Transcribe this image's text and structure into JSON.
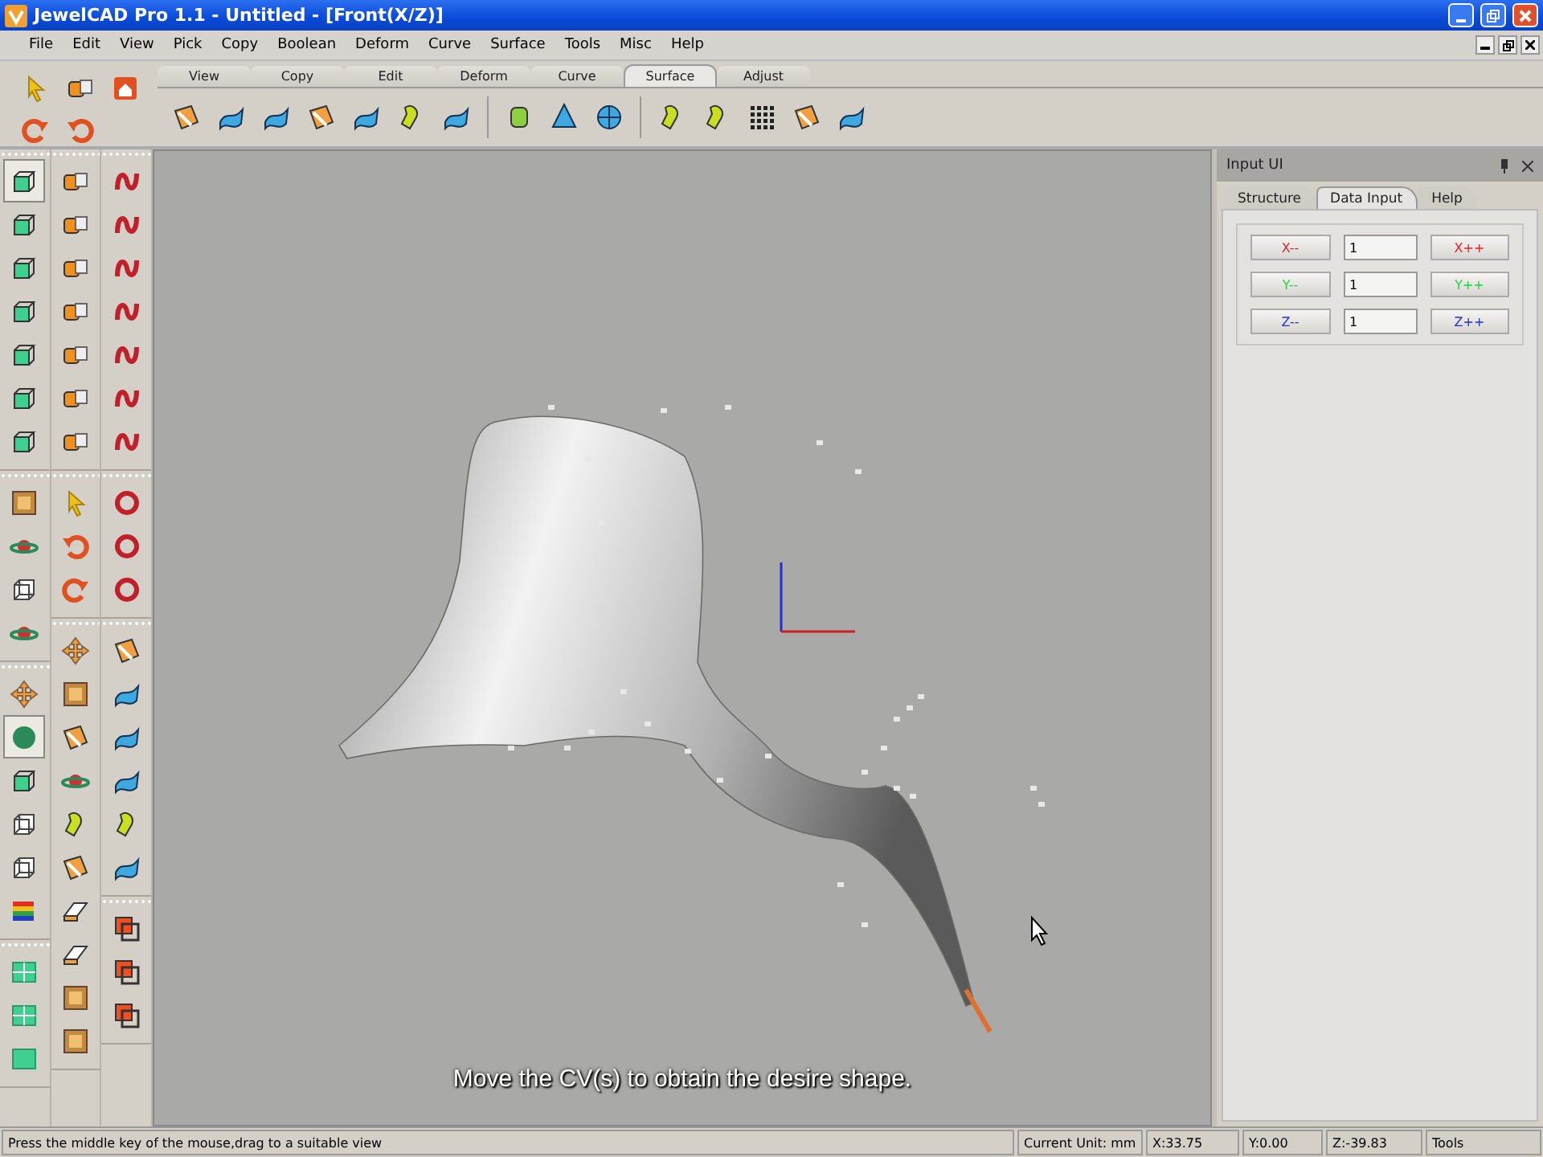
{
  "window": {
    "title": "JewelCAD Pro 1.1 - Untitled - [Front(X/Z)]"
  },
  "menu": [
    "File",
    "Edit",
    "View",
    "Pick",
    "Copy",
    "Boolean",
    "Deform",
    "Curve",
    "Surface",
    "Tools",
    "Misc",
    "Help"
  ],
  "toolbar_tabs": [
    {
      "label": "View",
      "selected": false
    },
    {
      "label": "Copy",
      "selected": false
    },
    {
      "label": "Edit",
      "selected": false
    },
    {
      "label": "Deform",
      "selected": false
    },
    {
      "label": "Curve",
      "selected": false
    },
    {
      "label": "Surface",
      "selected": true
    },
    {
      "label": "Adjust",
      "selected": false
    }
  ],
  "tool_columns": [
    {
      "groups": [
        [
          {
            "selected": true
          },
          {
            "selected": false
          },
          {
            "selected": false
          },
          {
            "selected": false
          },
          {
            "selected": false
          },
          {
            "selected": false
          },
          {
            "selected": false
          }
        ],
        [
          {
            "selected": false
          },
          {
            "selected": false
          },
          {
            "selected": false
          },
          {
            "selected": false
          }
        ],
        [
          {
            "selected": false
          },
          {
            "selected": true
          },
          {
            "selected": false
          },
          {
            "selected": false
          },
          {
            "selected": false
          },
          {
            "selected": false
          }
        ],
        [
          {
            "selected": false
          },
          {
            "selected": false
          },
          {
            "selected": false
          }
        ]
      ]
    },
    {
      "groups": [
        [
          {
            "selected": false
          },
          {
            "selected": false
          },
          {
            "selected": false
          },
          {
            "selected": false
          },
          {
            "selected": false
          },
          {
            "selected": false
          },
          {
            "selected": false
          }
        ],
        [
          {
            "selected": false
          },
          {
            "selected": false
          },
          {
            "selected": false
          }
        ],
        [
          {
            "selected": false
          },
          {
            "selected": false
          },
          {
            "selected": false
          },
          {
            "selected": false
          },
          {
            "selected": false
          },
          {
            "selected": false
          },
          {
            "selected": false
          },
          {
            "selected": false
          },
          {
            "selected": false
          },
          {
            "selected": false
          }
        ]
      ]
    },
    {
      "groups": [
        [
          {
            "selected": false
          },
          {
            "selected": false
          },
          {
            "selected": false
          },
          {
            "selected": false
          },
          {
            "selected": false
          },
          {
            "selected": false
          },
          {
            "selected": false
          }
        ],
        [
          {
            "selected": false
          },
          {
            "selected": false
          },
          {
            "selected": false
          }
        ],
        [
          {
            "selected": false
          },
          {
            "selected": false
          },
          {
            "selected": false
          },
          {
            "selected": false
          },
          {
            "selected": false
          },
          {
            "selected": false
          }
        ],
        [
          {
            "selected": false
          },
          {
            "selected": false
          },
          {
            "selected": false
          }
        ]
      ]
    }
  ],
  "viewport": {
    "caption": "Move the CV(s) to obtain the desire shape."
  },
  "input_panel": {
    "title": "Input UI",
    "tabs": [
      {
        "label": "Structure",
        "selected": false
      },
      {
        "label": "Data Input",
        "selected": true
      },
      {
        "label": "Help",
        "selected": false
      }
    ],
    "rows": [
      {
        "minus": "X--",
        "value": "1",
        "plus": "X++",
        "color": "#e0202a"
      },
      {
        "minus": "Y--",
        "value": "1",
        "plus": "Y++",
        "color": "#20d040"
      },
      {
        "minus": "Z--",
        "value": "1",
        "plus": "Z++",
        "color": "#2030d0"
      }
    ]
  },
  "status_bar": {
    "message": "Press the middle key of the mouse,drag to a suitable view",
    "unit": "Current Unit:  mm",
    "x": "X:33.75",
    "y": "Y:0.00",
    "z": "Z:-39.83",
    "mode": "Tools"
  }
}
